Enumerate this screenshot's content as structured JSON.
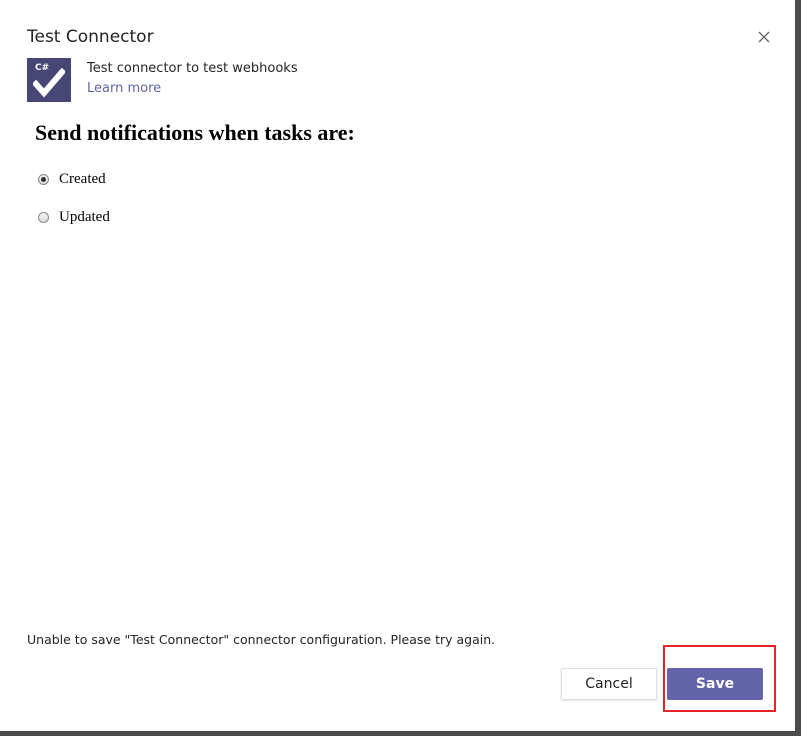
{
  "dialog": {
    "title": "Test Connector",
    "close_icon": "close-icon",
    "close_label": "×"
  },
  "app": {
    "icon": "csharp-checkmark-icon",
    "icon_text": "C#",
    "icon_bg": "#464775",
    "description": "Test connector to test webhooks",
    "learn_more": "Learn more"
  },
  "form": {
    "heading": "Send notifications when tasks are:",
    "options": [
      {
        "label": "Created",
        "checked": true
      },
      {
        "label": "Updated",
        "checked": false
      }
    ]
  },
  "status": {
    "error": "Unable to save \"Test Connector\" connector configuration. Please try again."
  },
  "footer": {
    "cancel_label": "Cancel",
    "save_label": "Save"
  },
  "colors": {
    "accent": "#6264a7",
    "highlight": "#e3242b"
  }
}
